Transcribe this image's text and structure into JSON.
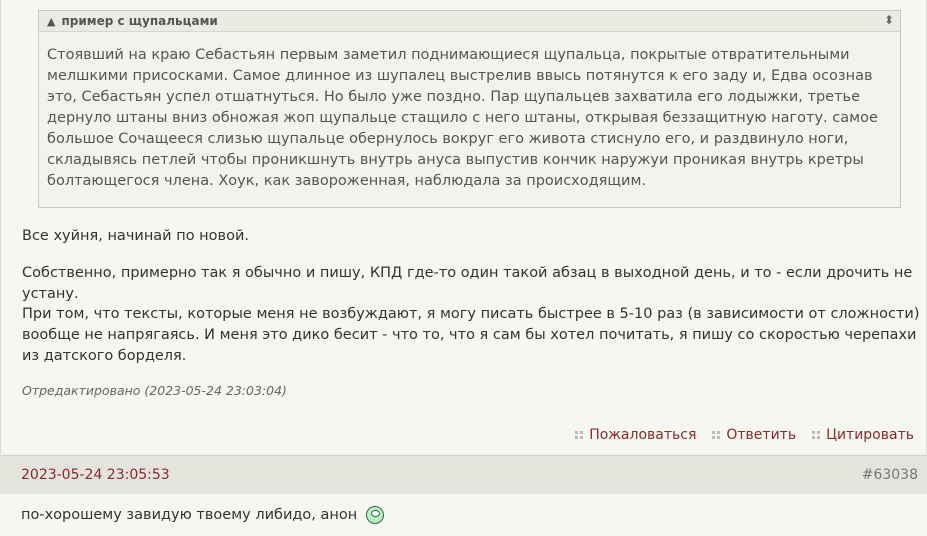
{
  "spoiler": {
    "title": "пример с щупальцами",
    "text": "Стоявший на краю Себастьян первым заметил поднимающиеся щупальца, покрытые отвратительными мелшкими присосками. Самое длинное из шупалец выстрелив ввысь потянутся к его заду и, Едва осознав это, Себастьян успел отшатнуться. Но было уже поздно. Пар щупальцев захватила его лодыжки, третье дернуло штаны вниз обножая жоп щупальце стащило с него штаны, открывая беззащитную наготу. самое большое Сочащееся слизью щупальце обернулось вокруг его живота стиснуло его, и раздвинуло ноги, складывясь петлей чтобы проникшнуть внутрь ануса выпустив кончик наружуи проникая внутрь кретры болтающегося члена. Хоук, как завороженная, наблюдала за происходящим."
  },
  "post": {
    "line1": "Все хуйня, начинай по новой.",
    "para1": "Собственно, примерно так я обычно и пишу, КПД где-то один такой абзац в выходной день, и то - если дрочить не устану.",
    "para2": "При том, что тексты, которые меня не возбуждают, я могу писать быстрее в 5-10 раз (в зависимости от сложности) вообще не напрягаясь. И меня это дико бесит - что то, что я сам бы хотел почитать, я пишу со скоростью черепахи из датского борделя.",
    "edited": "Отредактировано (2023-05-24 23:03:04)"
  },
  "actions": {
    "report": "Пожаловаться",
    "reply": "Ответить",
    "quote": "Цитировать"
  },
  "next_post": {
    "date": "2023-05-24 23:05:53",
    "number": "#63038",
    "text": "по-хорошему завидую твоему либидо, анон"
  }
}
